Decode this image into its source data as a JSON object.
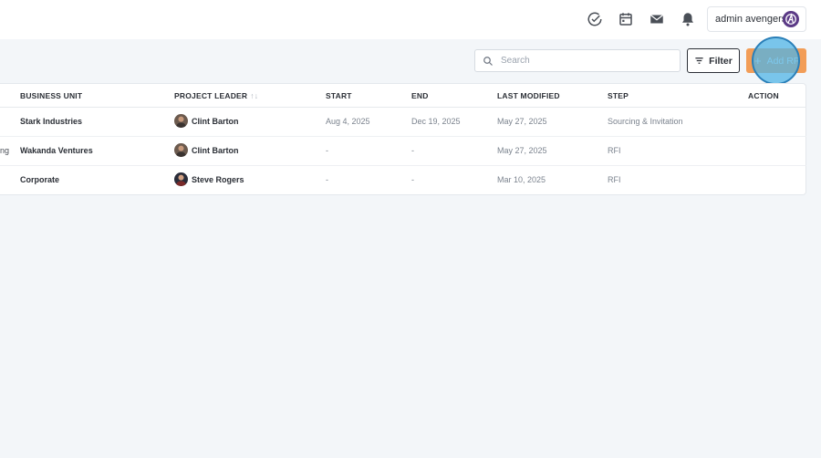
{
  "topbar": {
    "icons": [
      "check-circle-icon",
      "calendar-icon",
      "mail-icon",
      "bell-icon"
    ],
    "user": {
      "name": "admin avengers",
      "avatar": "avengers-logo-icon"
    }
  },
  "toolbar": {
    "search_placeholder": "Search",
    "filter_label": "Filter",
    "add_label": "Add RF"
  },
  "table": {
    "columns": [
      "BUSINESS UNIT",
      "PROJECT LEADER",
      "START",
      "END",
      "LAST MODIFIED",
      "STEP",
      "ACTION"
    ],
    "sort_arrows": "↑↓",
    "rows": [
      {
        "prefix": "",
        "business_unit": "Stark Industries",
        "leader": "Clint Barton",
        "start": "Aug 4, 2025",
        "end": "Dec 19, 2025",
        "last_modified": "May 27, 2025",
        "step": "Sourcing & Invitation"
      },
      {
        "prefix": "ng",
        "business_unit": "Wakanda Ventures",
        "leader": "Clint Barton",
        "start": "-",
        "end": "-",
        "last_modified": "May 27, 2025",
        "step": "RFI"
      },
      {
        "prefix": "",
        "business_unit": "Corporate",
        "leader": "Steve Rogers",
        "start": "-",
        "end": "-",
        "last_modified": "Mar 10, 2025",
        "step": "RFI"
      }
    ]
  },
  "colors": {
    "background": "#f3f6f9",
    "accent": "#f29d57",
    "click_highlight": "#50b4e6"
  }
}
